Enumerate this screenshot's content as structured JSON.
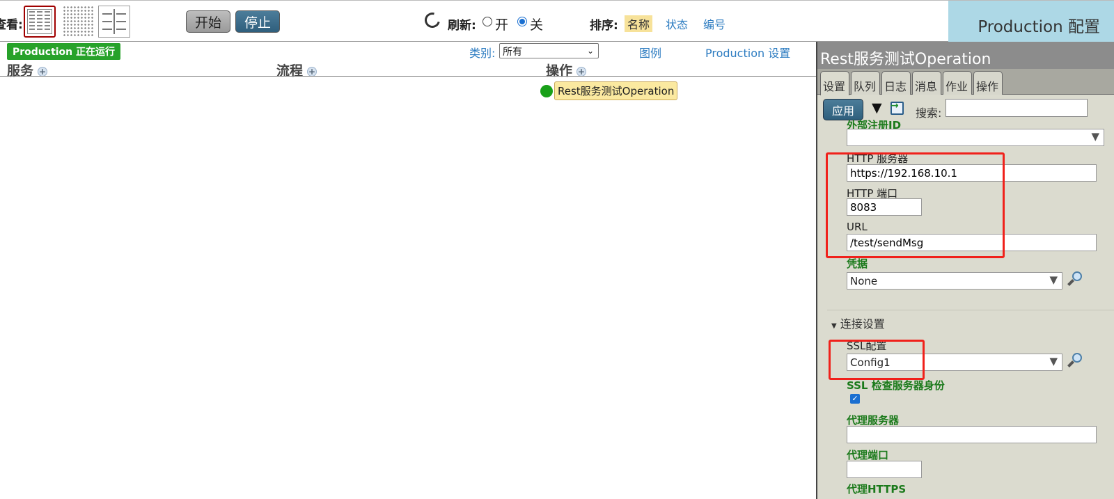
{
  "toolbar": {
    "view_label": "查看:",
    "start_label": "开始",
    "stop_label": "停止",
    "refresh_label": "刷新:",
    "refresh_on_label": "开",
    "refresh_off_label": "关",
    "sort_label": "排序:",
    "sort_options": [
      "名称",
      "状态",
      "编号"
    ],
    "config_title": "Production 配置"
  },
  "filters": {
    "running_badge": "Production 正在运行",
    "category_label": "类别:",
    "category_value": "所有",
    "legend_link": "图例",
    "production_settings_link": "Production 设置"
  },
  "columns": {
    "services": "服务",
    "processes": "流程",
    "operations": "操作"
  },
  "operations": [
    {
      "label": "Rest服务测试Operation",
      "status_color": "#19a019"
    }
  ],
  "panel": {
    "title": "Rest服务测试Operation",
    "tabs": [
      "设置",
      "队列",
      "日志",
      "消息",
      "作业",
      "操作"
    ],
    "active_tab": "设置",
    "apply_label": "应用",
    "search_label": "搜索:",
    "search_value": "",
    "fields": {
      "ext_reg_label": "外部注册ID",
      "ext_reg_value": "",
      "http_server_label": "HTTP 服务器",
      "http_server_value": "https://192.168.10.1",
      "http_port_label": "HTTP 端口",
      "http_port_value": "8083",
      "url_label": "URL",
      "url_value": "/test/sendMsg",
      "credential_label": "凭据",
      "credential_value": "None",
      "connection_section": "连接设置",
      "ssl_config_label": "SSL配置",
      "ssl_config_value": "Config1",
      "ssl_verify_label": "SSL 检查服务器身份",
      "ssl_verify_checked": true,
      "proxy_server_label": "代理服务器",
      "proxy_server_value": "",
      "proxy_port_label": "代理端口",
      "proxy_port_value": "",
      "proxy_https_label": "代理HTTPS"
    }
  },
  "colors": {
    "accent_blue": "#2f5f7d",
    "running_green": "#27a22a",
    "highlight_red": "#f0211b",
    "config_header_bg": "#add8e6"
  }
}
